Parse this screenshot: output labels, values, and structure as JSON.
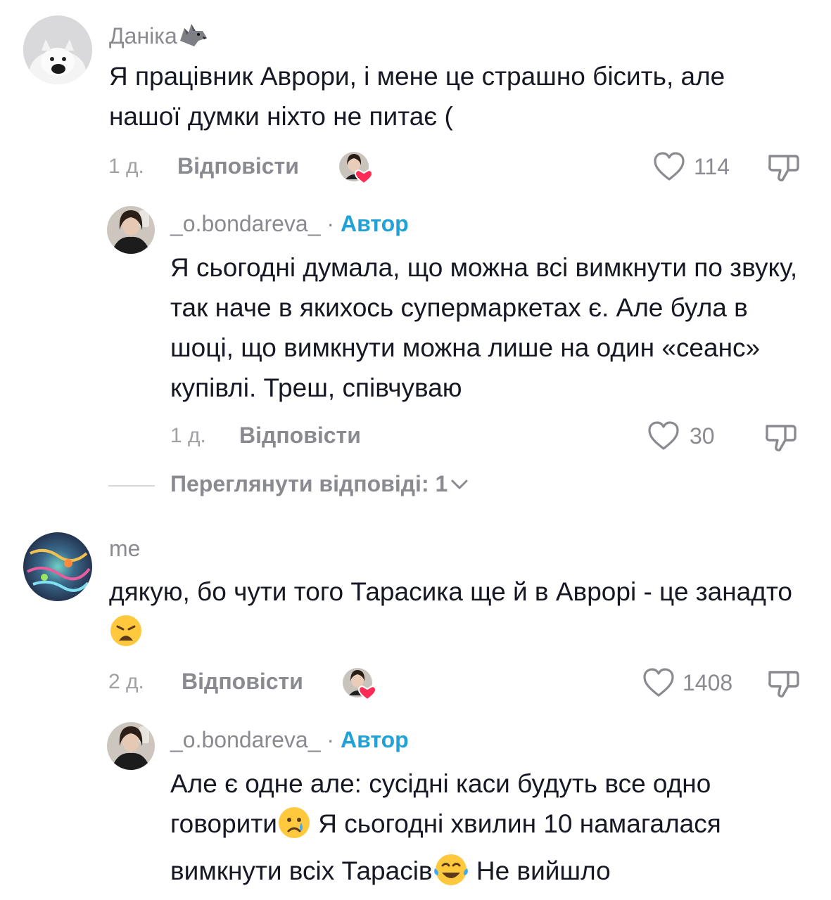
{
  "comments": [
    {
      "username": "Даніка",
      "text": "Я працівник Аврори, і мене це страшно бісить, але нашої думки ніхто не питає (",
      "time": "1 д.",
      "reply_label": "Відповісти",
      "likes": "114"
    },
    {
      "username": "me",
      "text_1": "дякую, бо чути того Тарасика ще й в Аврорі - це занадто",
      "time": "2 д.",
      "reply_label": "Відповісти",
      "likes": "1408"
    }
  ],
  "replies": [
    {
      "username": "_o.bondareva_",
      "separator": "·",
      "author_badge": "Автор",
      "text": "Я сьогодні думала, що можна всі вимкнути по звуку, так наче в якихось супермаркетах є. Але була в шоці, що вимкнути можна лише на один «сеанс» купівлі. Треш, співчуваю",
      "time": "1 д.",
      "reply_label": "Відповісти",
      "likes": "30",
      "view_replies": "Переглянути відповіді: 1"
    },
    {
      "username": "_o.bondareva_",
      "separator": "·",
      "author_badge": "Автор",
      "text_1": "Але є одне але: сусідні каси будуть все одно говорити",
      "text_2": " Я сьогодні хвилин 10 намагалася вимкнути всіх Тарасів",
      "text_3": " Не вийшло"
    }
  ],
  "icons": {
    "like": "heart-outline-icon",
    "dislike": "thumbs-down-icon",
    "creator_liked": "creator-liked-heart-icon",
    "chevron": "chevron-down-icon"
  },
  "colors": {
    "author": "#20a1d8",
    "heart_badge": "#fe2c55",
    "muted": "#8a8b91"
  }
}
